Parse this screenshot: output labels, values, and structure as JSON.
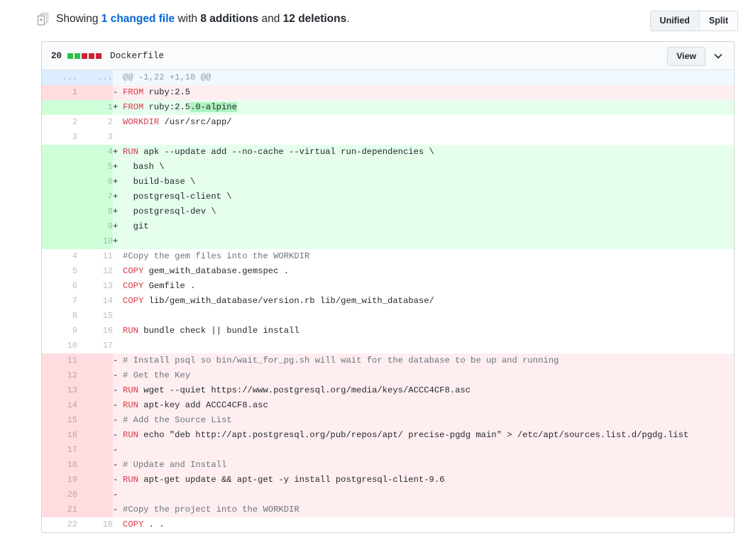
{
  "toolbar": {
    "icon": "files-diff-icon",
    "summary_prefix": "Showing ",
    "changed_files_link": "1 changed file",
    "summary_mid": " with ",
    "additions": "8 additions",
    "summary_and": " and ",
    "deletions": "12 deletions",
    "summary_suffix": ".",
    "view_modes": [
      {
        "label": "Unified",
        "selected": true
      },
      {
        "label": "Split",
        "selected": false
      }
    ]
  },
  "file": {
    "diffstat_count": "20",
    "diffstat_blocks": [
      "add",
      "add",
      "del",
      "del",
      "del"
    ],
    "name": "Dockerfile",
    "view_button": "View",
    "chevron_icon": "chevron-down-icon"
  },
  "colors": {
    "link": "#0366d6",
    "addition_bg": "#e6ffed",
    "addition_gutter": "#cdffd8",
    "addition_word": "#acf2bd",
    "deletion_bg": "#ffeef0",
    "deletion_gutter": "#ffdce0",
    "deletion_word": "#fdb8c0",
    "hunk_bg": "#f1f8ff",
    "hunk_gutter": "#dbedff",
    "keyword": "#d73a49",
    "comment": "#6a737d",
    "diffstat_add": "#2cbe4e",
    "diffstat_del": "#cb2431"
  },
  "diff": {
    "rows": [
      {
        "type": "hunk",
        "old": "...",
        "new": "...",
        "marker": "",
        "text": "@@ -1,22 +1,18 @@"
      },
      {
        "type": "del",
        "old": "1",
        "new": "",
        "marker": "-",
        "text": "FROM ruby:2.5",
        "kw": "FROM"
      },
      {
        "type": "add",
        "old": "",
        "new": "1",
        "marker": "+",
        "text": "FROM ruby:2.5.0-alpine",
        "kw": "FROM",
        "word_start": "FROM ruby:2.5",
        "word_hl": ".0-alpine"
      },
      {
        "type": "ctx",
        "old": "2",
        "new": "2",
        "marker": "",
        "text": "WORKDIR /usr/src/app/",
        "kw": "WORKDIR"
      },
      {
        "type": "ctx",
        "old": "3",
        "new": "3",
        "marker": "",
        "text": ""
      },
      {
        "type": "add",
        "old": "",
        "new": "4",
        "marker": "+",
        "text": "RUN apk --update add --no-cache --virtual run-dependencies \\",
        "kw": "RUN"
      },
      {
        "type": "add",
        "old": "",
        "new": "5",
        "marker": "+",
        "text": "  bash \\"
      },
      {
        "type": "add",
        "old": "",
        "new": "6",
        "marker": "+",
        "text": "  build-base \\"
      },
      {
        "type": "add",
        "old": "",
        "new": "7",
        "marker": "+",
        "text": "  postgresql-client \\"
      },
      {
        "type": "add",
        "old": "",
        "new": "8",
        "marker": "+",
        "text": "  postgresql-dev \\"
      },
      {
        "type": "add",
        "old": "",
        "new": "9",
        "marker": "+",
        "text": "  git"
      },
      {
        "type": "add",
        "old": "",
        "new": "10",
        "marker": "+",
        "text": ""
      },
      {
        "type": "ctx",
        "old": "4",
        "new": "11",
        "marker": "",
        "text": "#Copy the gem files into the WORKDIR",
        "comment": true
      },
      {
        "type": "ctx",
        "old": "5",
        "new": "12",
        "marker": "",
        "text": "COPY gem_with_database.gemspec .",
        "kw": "COPY"
      },
      {
        "type": "ctx",
        "old": "6",
        "new": "13",
        "marker": "",
        "text": "COPY Gemfile .",
        "kw": "COPY"
      },
      {
        "type": "ctx",
        "old": "7",
        "new": "14",
        "marker": "",
        "text": "COPY lib/gem_with_database/version.rb lib/gem_with_database/",
        "kw": "COPY"
      },
      {
        "type": "ctx",
        "old": "8",
        "new": "15",
        "marker": "",
        "text": ""
      },
      {
        "type": "ctx",
        "old": "9",
        "new": "16",
        "marker": "",
        "text": "RUN bundle check || bundle install",
        "kw": "RUN"
      },
      {
        "type": "ctx",
        "old": "10",
        "new": "17",
        "marker": "",
        "text": ""
      },
      {
        "type": "del",
        "old": "11",
        "new": "",
        "marker": "-",
        "text": "# Install psql so bin/wait_for_pg.sh will wait for the database to be up and running",
        "comment": true
      },
      {
        "type": "del",
        "old": "12",
        "new": "",
        "marker": "-",
        "text": "# Get the Key",
        "comment": true
      },
      {
        "type": "del",
        "old": "13",
        "new": "",
        "marker": "-",
        "text": "RUN wget --quiet https://www.postgresql.org/media/keys/ACCC4CF8.asc",
        "kw": "RUN"
      },
      {
        "type": "del",
        "old": "14",
        "new": "",
        "marker": "-",
        "text": "RUN apt-key add ACCC4CF8.asc",
        "kw": "RUN"
      },
      {
        "type": "del",
        "old": "15",
        "new": "",
        "marker": "-",
        "text": "# Add the Source List",
        "comment": true
      },
      {
        "type": "del",
        "old": "16",
        "new": "",
        "marker": "-",
        "text": "RUN echo \"deb http://apt.postgresql.org/pub/repos/apt/ precise-pgdg main\" > /etc/apt/sources.list.d/pgdg.list",
        "kw": "RUN"
      },
      {
        "type": "del",
        "old": "17",
        "new": "",
        "marker": "-",
        "text": ""
      },
      {
        "type": "del",
        "old": "18",
        "new": "",
        "marker": "-",
        "text": "# Update and Install",
        "comment": true
      },
      {
        "type": "del",
        "old": "19",
        "new": "",
        "marker": "-",
        "text": "RUN apt-get update && apt-get -y install postgresql-client-9.6",
        "kw": "RUN"
      },
      {
        "type": "del",
        "old": "20",
        "new": "",
        "marker": "-",
        "text": ""
      },
      {
        "type": "del",
        "old": "21",
        "new": "",
        "marker": "-",
        "text": "#Copy the project into the WORKDIR",
        "comment": true
      },
      {
        "type": "ctx",
        "old": "22",
        "new": "18",
        "marker": "",
        "text": "COPY . .",
        "kw": "COPY"
      }
    ]
  }
}
